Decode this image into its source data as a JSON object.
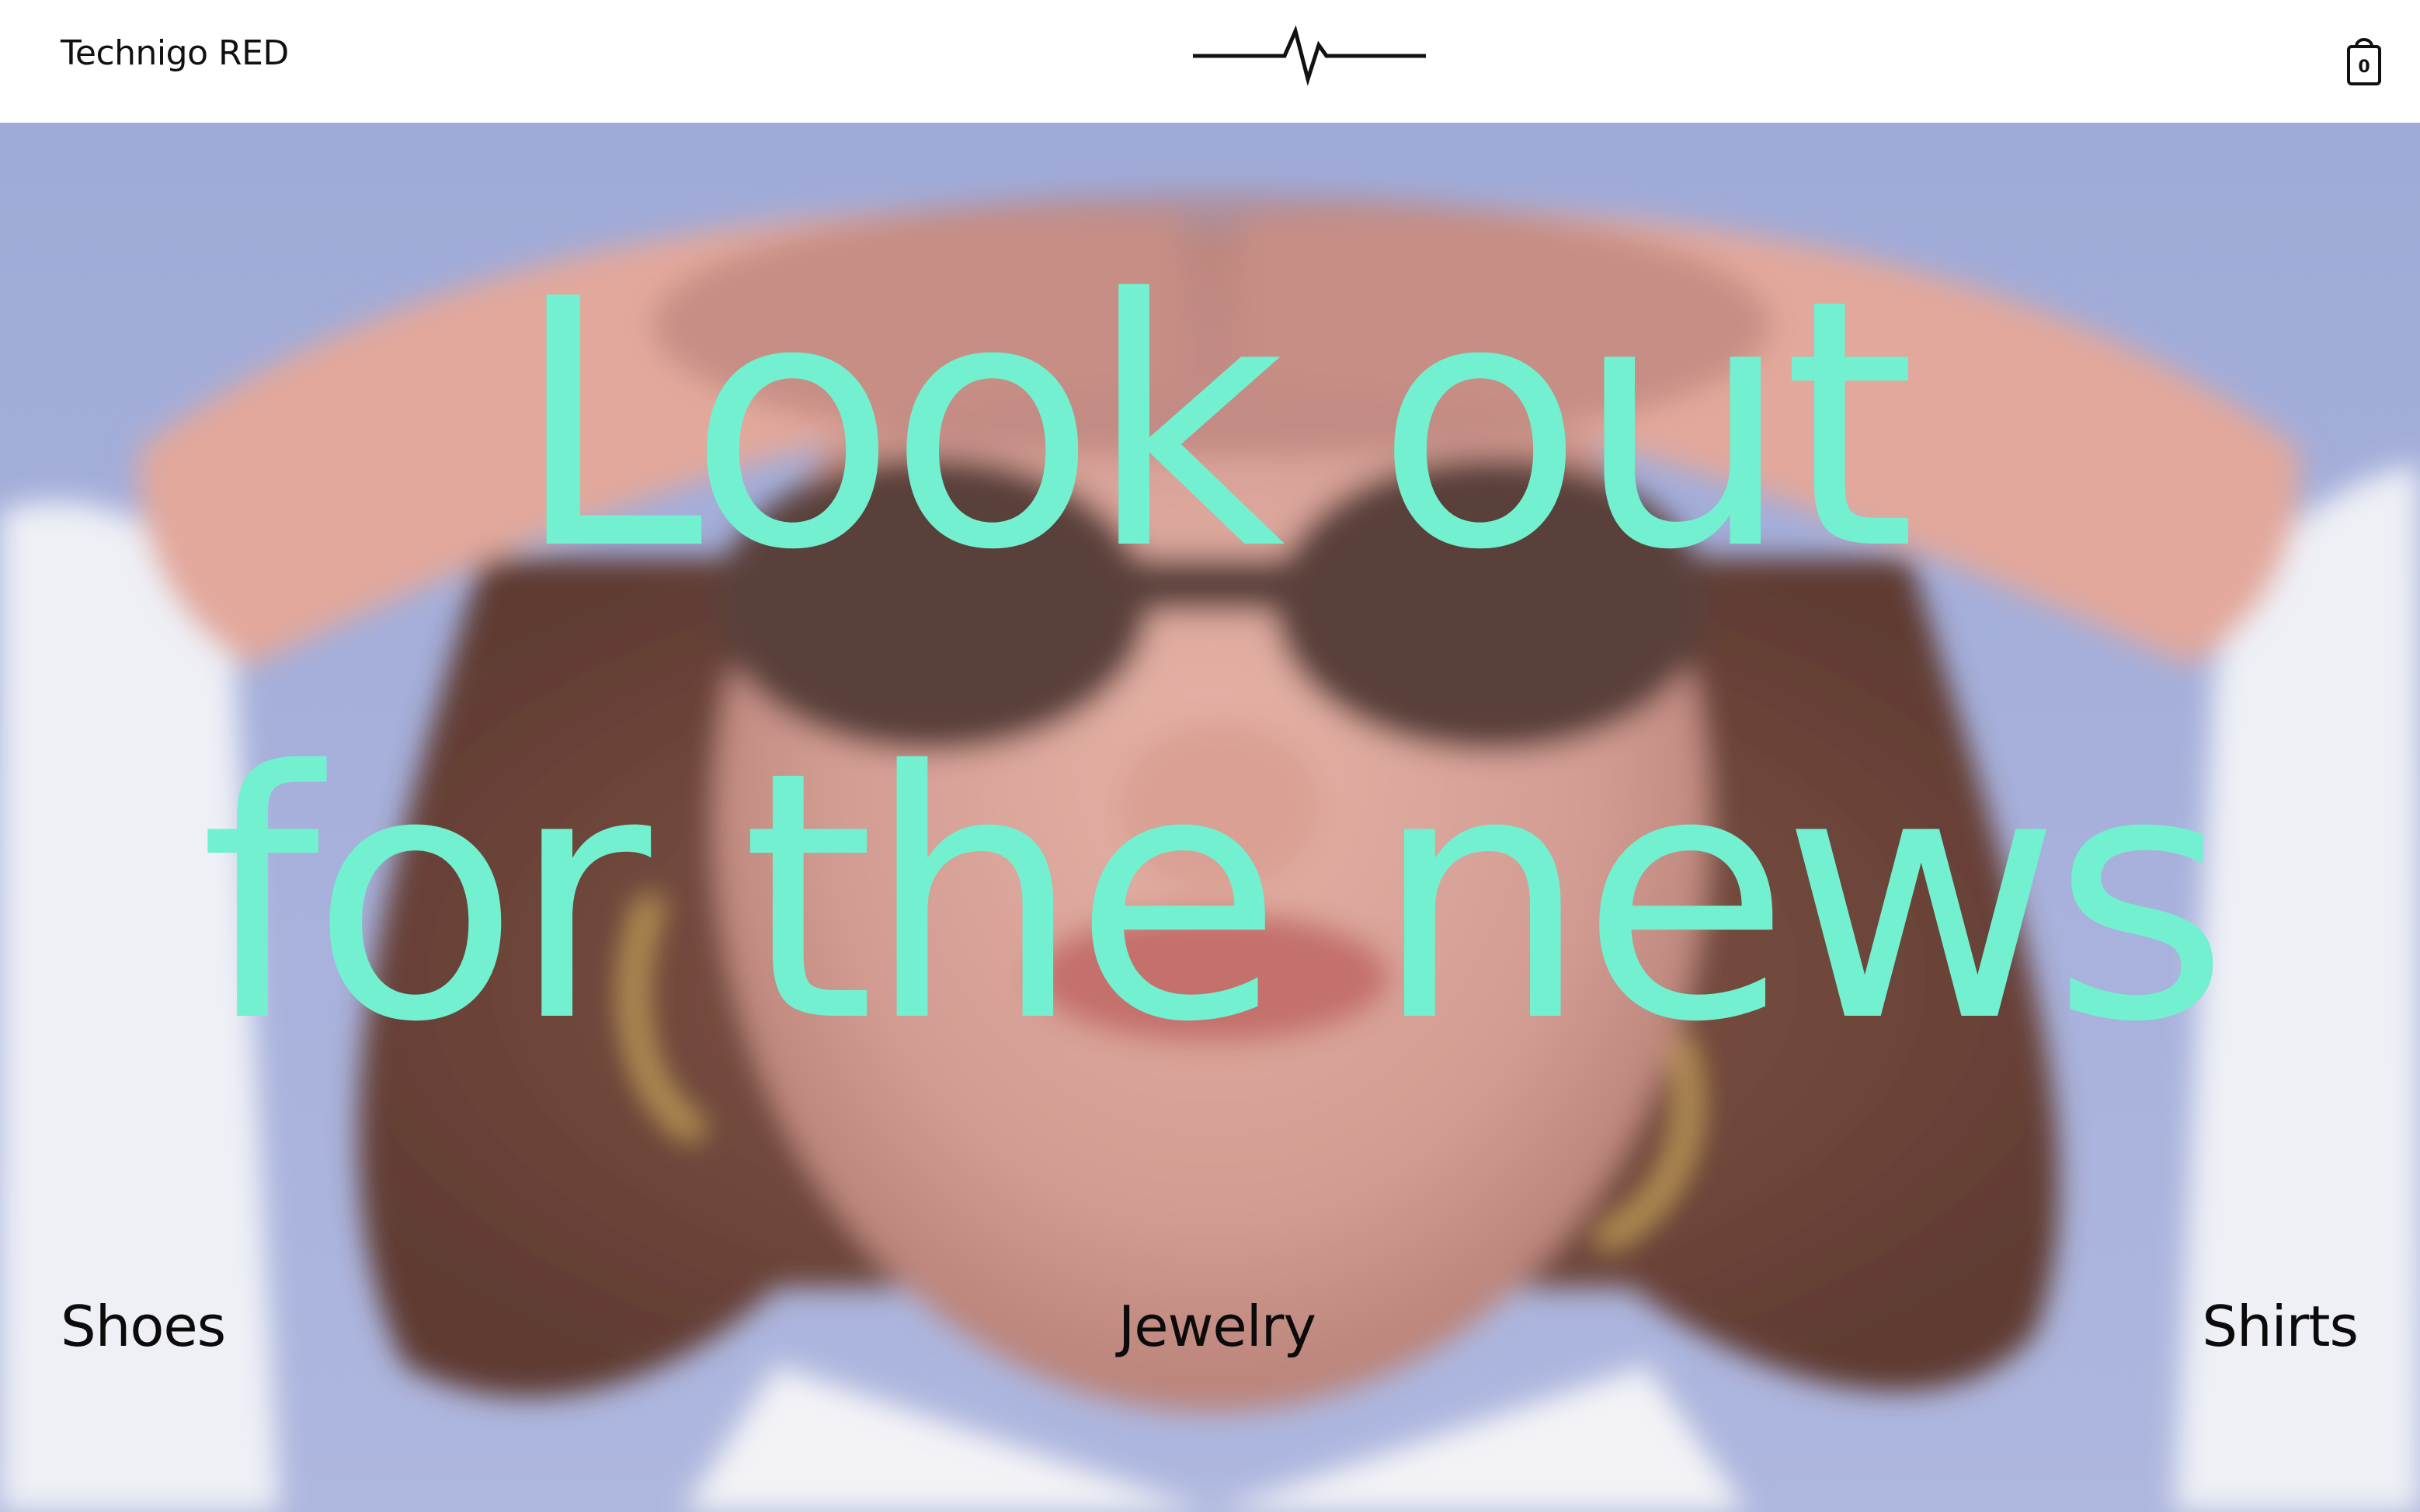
{
  "header": {
    "brand": "Technigo RED",
    "cart_count": "0",
    "logo_icon": "heartbeat-line-icon",
    "cart_icon": "shopping-bag-icon"
  },
  "hero": {
    "headline_line1": "Look out",
    "headline_line2": "for the news",
    "headline_color": "#72f0d0"
  },
  "categories": [
    {
      "label": "Shoes"
    },
    {
      "label": "Jewelry"
    },
    {
      "label": "Shirts"
    }
  ]
}
